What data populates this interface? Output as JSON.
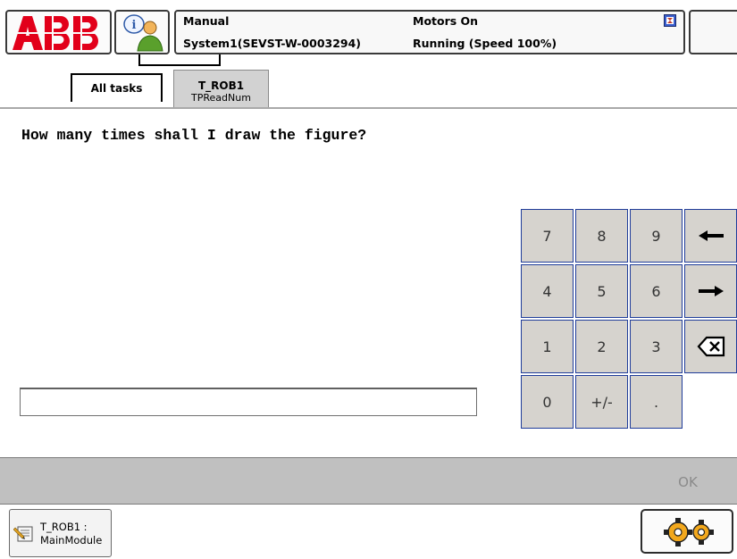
{
  "header": {
    "logo_text": "ABB",
    "status": {
      "mode": "Manual",
      "system": "System1(SEVST-W-0003294)",
      "motors": "Motors On",
      "running": "Running (Speed 100%)"
    },
    "icons": {
      "logo": "abb-logo",
      "info": "info-person-icon",
      "status_flag": "status-flag-icon"
    }
  },
  "tabs": [
    {
      "label": "All tasks"
    },
    {
      "title": "T_ROB1",
      "subtitle": "TPReadNum"
    }
  ],
  "main": {
    "question": "How many times shall I draw the figure?",
    "input_value": ""
  },
  "keypad": {
    "keys": [
      [
        "7",
        "8",
        "9",
        "left-arrow"
      ],
      [
        "4",
        "5",
        "6",
        "right-arrow"
      ],
      [
        "1",
        "2",
        "3",
        "backspace"
      ],
      [
        "0",
        "+/-",
        "."
      ]
    ]
  },
  "action_bar": {
    "ok_label": "OK"
  },
  "taskbar": {
    "item_line1": "T_ROB1 :",
    "item_line2": "MainModule",
    "icons": {
      "module": "program-module-icon",
      "quickset": "quickset-gears-icon"
    }
  },
  "colors": {
    "abb_red": "#e2001a",
    "key_border": "#1f3c9a",
    "key_face": "#d6d3ce",
    "action_bar": "#c0c0c0"
  }
}
